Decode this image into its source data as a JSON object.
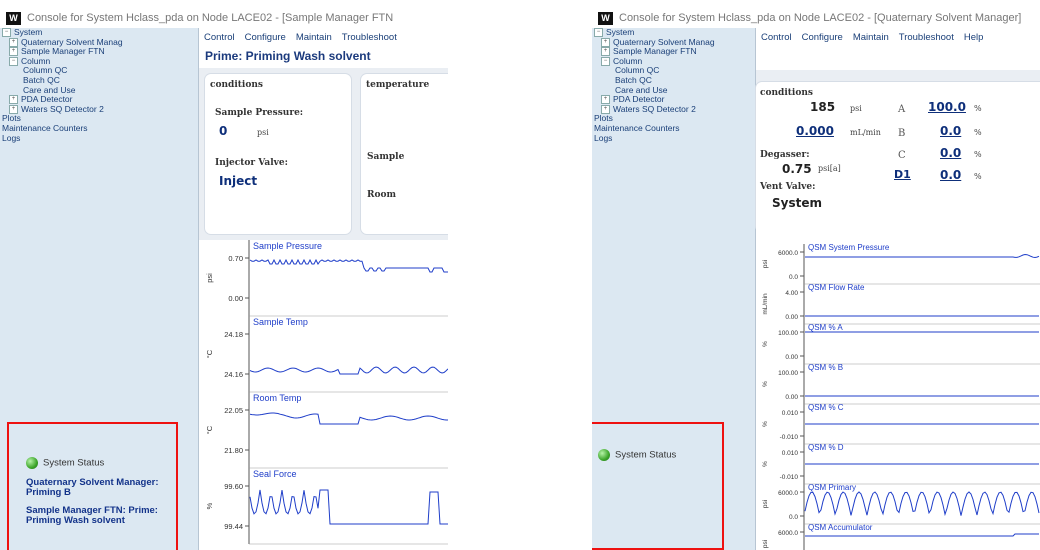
{
  "left": {
    "window_title": "Console for System Hclass_pda on Node LACE02 - [Sample Manager FTN",
    "tree": [
      {
        "label": "System",
        "indent": 0,
        "expander": "−"
      },
      {
        "label": "Quaternary Solvent Manag",
        "indent": 1,
        "expander": "+"
      },
      {
        "label": "Sample Manager FTN",
        "indent": 1,
        "expander": "+"
      },
      {
        "label": "Column",
        "indent": 1,
        "expander": "−"
      },
      {
        "label": "Column QC",
        "indent": 3,
        "expander": ""
      },
      {
        "label": "Batch QC",
        "indent": 3,
        "expander": ""
      },
      {
        "label": "Care and Use",
        "indent": 3,
        "expander": ""
      },
      {
        "label": "PDA Detector",
        "indent": 1,
        "expander": "+"
      },
      {
        "label": "Waters SQ Detector 2",
        "indent": 1,
        "expander": "+"
      },
      {
        "label": "Plots",
        "indent": 0,
        "expander": ""
      },
      {
        "label": "Maintenance Counters",
        "indent": 0,
        "expander": ""
      },
      {
        "label": "Logs",
        "indent": 0,
        "expander": ""
      }
    ],
    "menu": [
      "Control",
      "Configure",
      "Maintain",
      "Troubleshoot"
    ],
    "page_title": "Prime: Priming Wash solvent",
    "conditions": {
      "header": "conditions",
      "pressure_label": "Sample Pressure:",
      "pressure_value": "0",
      "pressure_unit": "psi",
      "valve_label": "Injector Valve:",
      "valve_value": "Inject"
    },
    "temperature": {
      "header": "temperature",
      "sample_label": "Sample",
      "room_label": "Room"
    },
    "status": {
      "label": "System Status",
      "message1": "Quaternary Solvent Manager: Priming B",
      "message2": "Sample Manager FTN: Prime: Priming Wash solvent"
    },
    "plots": [
      {
        "title": "Sample Pressure",
        "ticks": [
          "0.70",
          "0.00"
        ],
        "unit": "psi"
      },
      {
        "title": "Sample Temp",
        "ticks": [
          "24.18",
          "24.16"
        ],
        "unit": "°C"
      },
      {
        "title": "Room Temp",
        "ticks": [
          "22.05",
          "21.80"
        ],
        "unit": "°C"
      },
      {
        "title": "Seal Force",
        "ticks": [
          "99.60",
          "99.44"
        ],
        "unit": "%"
      }
    ]
  },
  "right": {
    "window_title": "Console for System Hclass_pda on Node LACE02 - [Quaternary Solvent Manager]",
    "tree": [
      {
        "label": "System",
        "indent": 0,
        "expander": "−"
      },
      {
        "label": "Quaternary Solvent Manag",
        "indent": 1,
        "expander": "+"
      },
      {
        "label": "Sample Manager FTN",
        "indent": 1,
        "expander": "+"
      },
      {
        "label": "Column",
        "indent": 1,
        "expander": "−"
      },
      {
        "label": "Column QC",
        "indent": 3,
        "expander": ""
      },
      {
        "label": "Batch QC",
        "indent": 3,
        "expander": ""
      },
      {
        "label": "Care and Use",
        "indent": 3,
        "expander": ""
      },
      {
        "label": "PDA Detector",
        "indent": 1,
        "expander": "+"
      },
      {
        "label": "Waters SQ Detector 2",
        "indent": 1,
        "expander": "+"
      },
      {
        "label": "Plots",
        "indent": 0,
        "expander": ""
      },
      {
        "label": "Maintenance Counters",
        "indent": 0,
        "expander": ""
      },
      {
        "label": "Logs",
        "indent": 0,
        "expander": ""
      }
    ],
    "menu": [
      "Control",
      "Configure",
      "Maintain",
      "Troubleshoot",
      "Help"
    ],
    "conditions": {
      "header": "conditions",
      "pressure_value": "185",
      "pressure_unit": "psi",
      "flow_value": "0.000",
      "flow_unit": "mL/min",
      "degasser_label": "Degasser:",
      "degasser_value": "0.75",
      "degasser_unit": "psi[a]",
      "vent_label": "Vent Valve:",
      "vent_value": "System",
      "solvents": [
        {
          "letter": "A",
          "value": "100.0",
          "unit": "%"
        },
        {
          "letter": "B",
          "value": "0.0",
          "unit": "%"
        },
        {
          "letter": "C",
          "value": "0.0",
          "unit": "%"
        },
        {
          "letter": "D1",
          "value": "0.0",
          "unit": "%"
        }
      ]
    },
    "status": {
      "label": "System Status"
    },
    "plots": [
      {
        "title": "QSM System Pressure",
        "ticks": [
          "6000.0",
          "0.0"
        ],
        "unit": "psi"
      },
      {
        "title": "QSM Flow Rate",
        "ticks": [
          "4.00",
          "0.00"
        ],
        "unit": "mL/min"
      },
      {
        "title": "QSM % A",
        "ticks": [
          "100.00",
          "0.00"
        ],
        "unit": "%"
      },
      {
        "title": "QSM % B",
        "ticks": [
          "100.00",
          "0.00"
        ],
        "unit": "%"
      },
      {
        "title": "QSM % C",
        "ticks": [
          "0.010",
          "-0.010"
        ],
        "unit": "%"
      },
      {
        "title": "QSM % D",
        "ticks": [
          "0.010",
          "-0.010"
        ],
        "unit": "%"
      },
      {
        "title": "QSM Primary",
        "ticks": [
          "6000.0",
          "0.0"
        ],
        "unit": "psi"
      },
      {
        "title": "QSM Accumulator",
        "ticks": [
          "6000.0"
        ],
        "unit": "psi"
      }
    ]
  },
  "colors": {
    "tree_bg": "#dce8f2",
    "value_blue": "#0e2f7a",
    "trace_blue": "#1f3ec9",
    "highlight_red": "#e11111",
    "status_green": "#3ca52a"
  }
}
